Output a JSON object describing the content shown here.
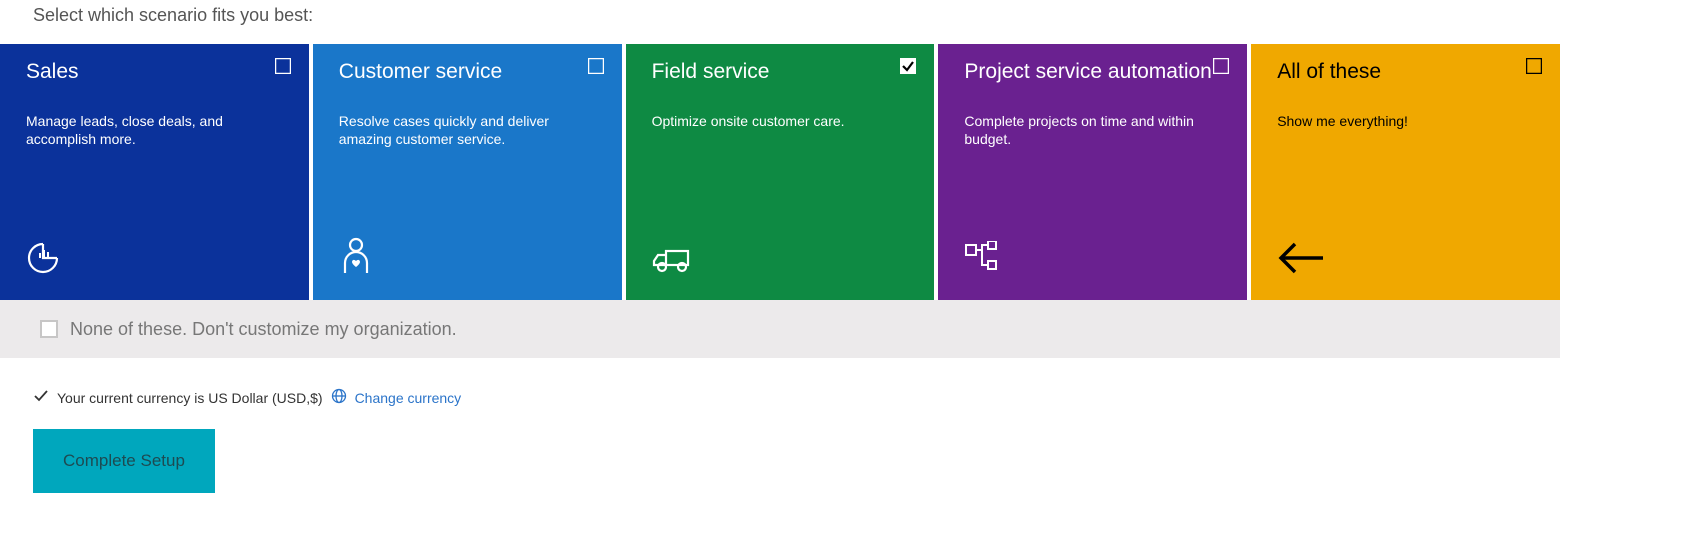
{
  "prompt": "Select which scenario fits you best:",
  "tiles": [
    {
      "title": "Sales",
      "desc": "Manage leads, close deals, and accomplish more.",
      "selected": false
    },
    {
      "title": "Customer service",
      "desc": "Resolve cases quickly and deliver amazing customer service.",
      "selected": false
    },
    {
      "title": "Field service",
      "desc": "Optimize onsite customer care.",
      "selected": true
    },
    {
      "title": "Project service automation",
      "desc": "Complete projects on time and within budget.",
      "selected": false
    },
    {
      "title": "All of these",
      "desc": "Show me everything!",
      "selected": false
    }
  ],
  "noneOption": "None of these. Don't customize my organization.",
  "currency": {
    "status": "Your current currency is US Dollar (USD,$)",
    "changeLink": "Change currency"
  },
  "button": "Complete Setup"
}
